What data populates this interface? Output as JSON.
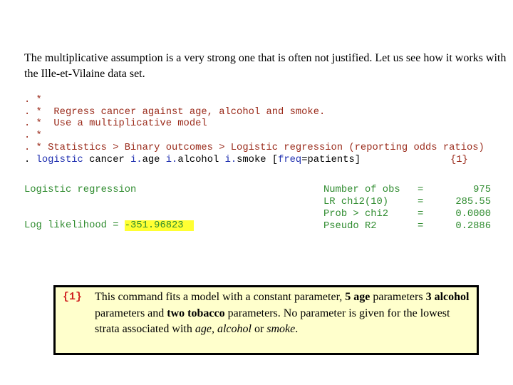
{
  "intro": "The multiplicative assumption is a very strong one that is often not justified.  Let us see how it works with the Ille-et-Vilaine data set.",
  "commands": {
    "comment_lines": [
      ". *",
      ". *  Regress cancer against age, alcohol and smoke.",
      ". *  Use a multiplicative model",
      ". *",
      ". * Statistics > Binary outcomes > Logistic regression (reporting odds ratios)"
    ],
    "command": {
      "prompt": ". ",
      "segments": [
        {
          "text": "logistic",
          "color": "blue"
        },
        {
          "text": " cancer ",
          "color": "black"
        },
        {
          "text": "i.",
          "color": "blue"
        },
        {
          "text": "age ",
          "color": "black"
        },
        {
          "text": "i.",
          "color": "blue"
        },
        {
          "text": "alcohol ",
          "color": "black"
        },
        {
          "text": "i.",
          "color": "blue"
        },
        {
          "text": "smoke [",
          "color": "black"
        },
        {
          "text": "freq",
          "color": "blue"
        },
        {
          "text": "=patients]",
          "color": "black"
        }
      ],
      "note_ref": "{1}"
    }
  },
  "output": {
    "title": "Logistic regression",
    "loglik_label": "Log likelihood = ",
    "loglik_value": "-351.96823",
    "stats": [
      {
        "label": "Number of obs",
        "eq": "=",
        "value": "975"
      },
      {
        "label": "LR chi2(10)",
        "eq": "=",
        "value": "285.55"
      },
      {
        "label": "Prob > chi2",
        "eq": "=",
        "value": "0.0000"
      },
      {
        "label": "Pseudo R2",
        "eq": "=",
        "value": "0.2886"
      }
    ]
  },
  "note": {
    "number": "{1}",
    "t1": "This command fits a model with a constant parameter, ",
    "b1": "5 age",
    "t2": " parameters ",
    "b2": "3 alcohol",
    "t3": " parameters and ",
    "b3": "two tobacco",
    "t4": " parameters.  No parameter is given for the lowest strata associated with ",
    "i1": "age, alcohol",
    "t5": " or ",
    "i2": "smoke",
    "t6": "."
  },
  "colors": {
    "comment": "#9a2a1a",
    "command": "#2030b0",
    "output": "#2e8b2e",
    "highlight": "#ffff33",
    "note_bg": "#ffffcc",
    "note_number": "#d02020"
  }
}
